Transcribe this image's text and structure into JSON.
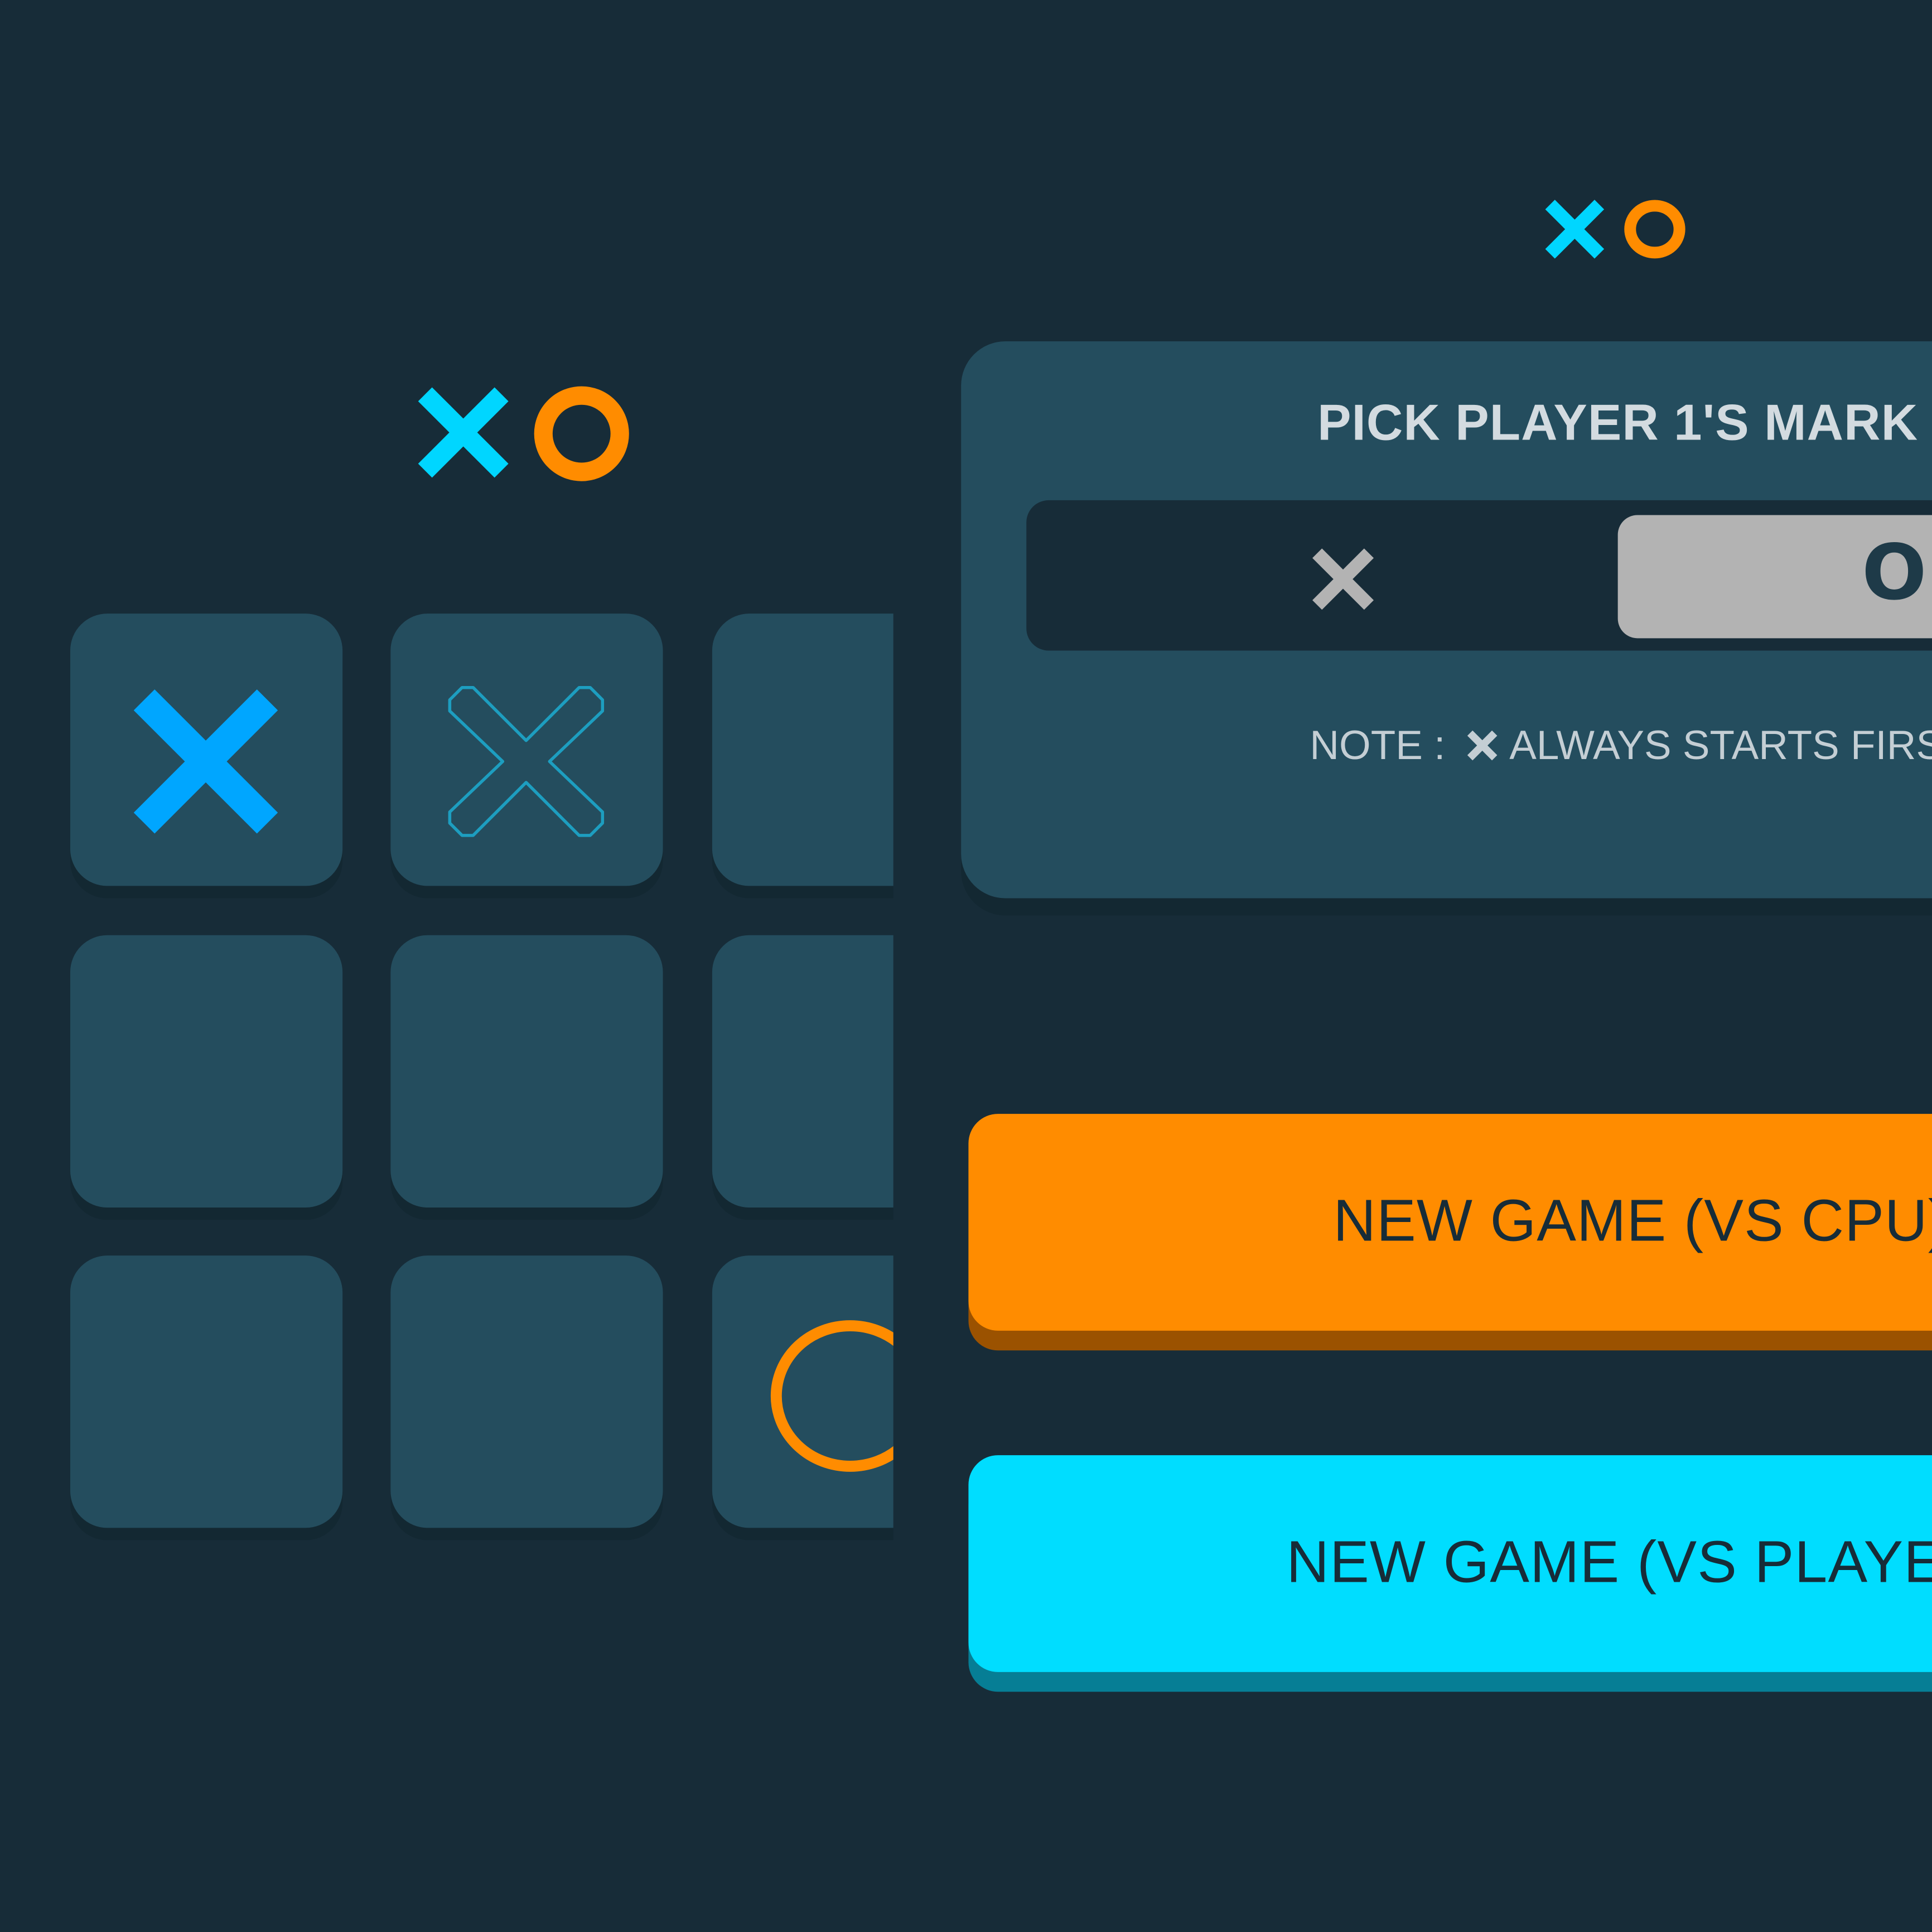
{
  "colors": {
    "background": "#172c38",
    "card": "#244d5e",
    "x_blue": "#00a6ff",
    "x_cyan": "#00d6ff",
    "o_orange": "#ff8c00",
    "toggle_selected": "#b3b3b3",
    "button_cpu": "#ff8c00",
    "button_player": "#00ddff"
  },
  "game_board": {
    "logo": {
      "x_icon": "x-mark-icon",
      "o_icon": "o-mark-icon"
    },
    "cells": [
      {
        "mark": "X",
        "style": "filled"
      },
      {
        "mark": "X",
        "style": "outline"
      },
      {
        "mark": "",
        "style": "empty"
      },
      {
        "mark": "",
        "style": "empty"
      },
      {
        "mark": "",
        "style": "empty"
      },
      {
        "mark": "",
        "style": "empty"
      },
      {
        "mark": "",
        "style": "empty"
      },
      {
        "mark": "",
        "style": "empty"
      },
      {
        "mark": "O",
        "style": "outline"
      }
    ]
  },
  "new_game_menu": {
    "logo": {
      "x_icon": "x-mark-icon",
      "o_icon": "o-mark-icon"
    },
    "pick_title": "PICK PLAYER 1'S MARK",
    "toggle": {
      "options": [
        {
          "label": "✕",
          "icon": "x-mark-icon",
          "selected": false
        },
        {
          "label": "O",
          "icon": "o-mark-icon",
          "selected": true
        }
      ]
    },
    "note": {
      "prefix": "NOTE :",
      "icon": "x-mark-icon",
      "text": "ALWAYS STARTS FIRST"
    },
    "buttons": {
      "vs_cpu": "NEW GAME (VS CPU)",
      "vs_player": "NEW GAME (VS PLAYER)"
    }
  }
}
